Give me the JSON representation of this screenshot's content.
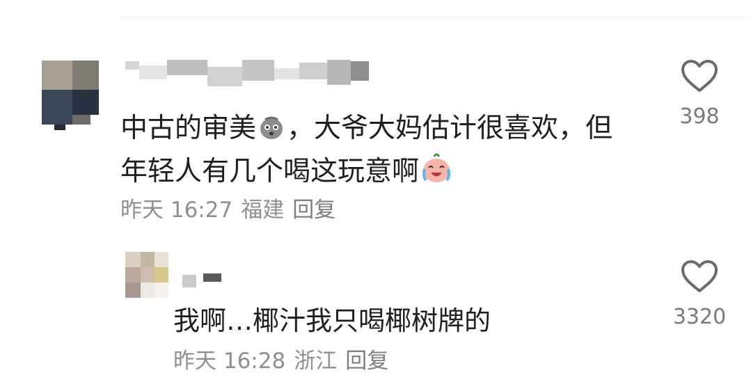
{
  "comments": [
    {
      "text_part1": "中古的审美",
      "emoji1": "worried-face-emoji",
      "text_part2": "，大爷大妈估计很喜欢，但年轻人有几个喝这玩意啊",
      "emoji2": "laughing-tears-emoji",
      "meta": {
        "time": "昨天 16:27",
        "location": "福建",
        "reply_label": "回复"
      },
      "likes": "398"
    },
    {
      "text": "我啊…椰汁我只喝椰树牌的",
      "meta": {
        "time": "昨天 16:28",
        "location": "浙江",
        "reply_label": "回复"
      },
      "likes": "3320"
    }
  ],
  "icons": {
    "like": "heart-outline-icon"
  },
  "colors": {
    "text": "#1f1f1f",
    "meta": "#8f8f8f",
    "like_count": "#7a7a7a",
    "icon": "#6a6a6a"
  }
}
